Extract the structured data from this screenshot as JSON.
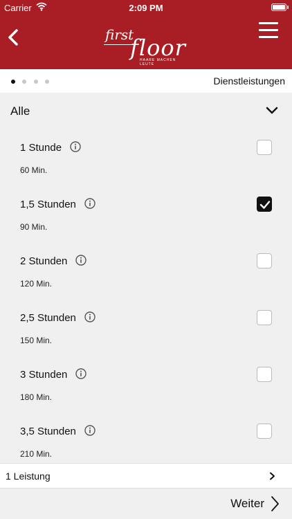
{
  "status_bar": {
    "carrier": "Carrier",
    "time": "2:09 PM"
  },
  "header": {
    "logo_word1": "first",
    "logo_word2": "floor",
    "logo_tagline": "HAARE MACHEN LEUTE",
    "brand_color": "#a91e25"
  },
  "steps": {
    "count": 4,
    "active_index": 0,
    "title": "Dienstleistungen"
  },
  "filter": {
    "label": "Alle"
  },
  "services": [
    {
      "name": "1 Stunde",
      "duration": "60 Min.",
      "checked": false
    },
    {
      "name": "1,5 Stunden",
      "duration": "90 Min.",
      "checked": true
    },
    {
      "name": "2 Stunden",
      "duration": "120 Min.",
      "checked": false
    },
    {
      "name": "2,5 Stunden",
      "duration": "150 Min.",
      "checked": false
    },
    {
      "name": "3 Stunden",
      "duration": "180 Min.",
      "checked": false
    },
    {
      "name": "3,5 Stunden",
      "duration": "210 Min.",
      "checked": false
    }
  ],
  "summary": {
    "text": "1 Leistung"
  },
  "footer": {
    "next_label": "Weiter"
  }
}
